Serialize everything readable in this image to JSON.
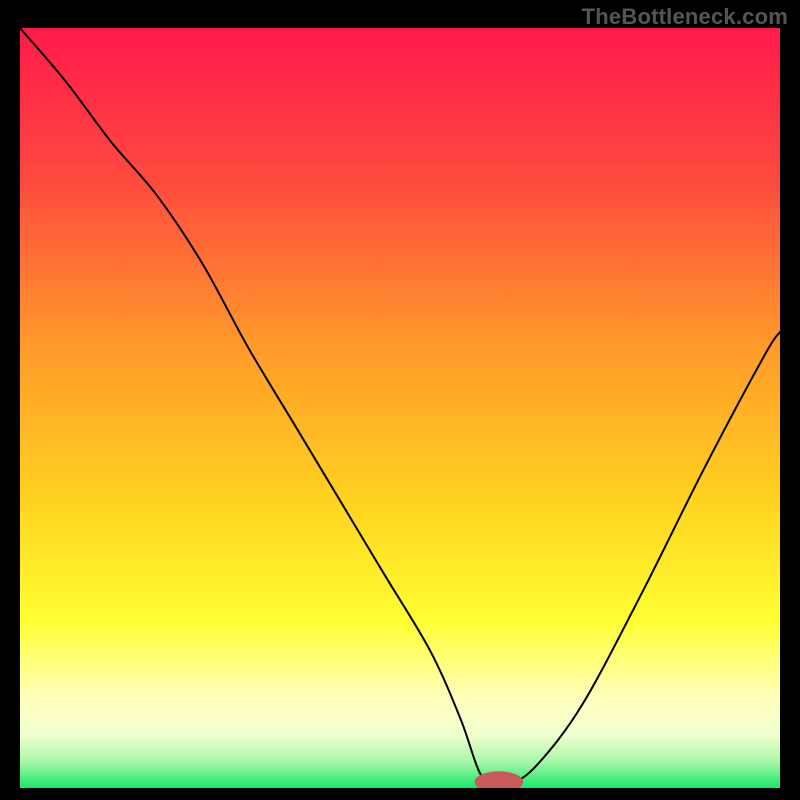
{
  "watermark": "TheBottleneck.com",
  "chart_data": {
    "type": "line",
    "title": "",
    "xlabel": "",
    "ylabel": "",
    "xlim": [
      0,
      100
    ],
    "ylim": [
      0,
      100
    ],
    "gradient_stops": [
      {
        "offset": 0.0,
        "color": "#ff1a4b"
      },
      {
        "offset": 0.2,
        "color": "#ff4a3e"
      },
      {
        "offset": 0.42,
        "color": "#ff9a2a"
      },
      {
        "offset": 0.62,
        "color": "#ffd21f"
      },
      {
        "offset": 0.78,
        "color": "#ffff33"
      },
      {
        "offset": 0.88,
        "color": "#ffffbb"
      },
      {
        "offset": 0.93,
        "color": "#f0ffd0"
      },
      {
        "offset": 0.965,
        "color": "#a8f7a8"
      },
      {
        "offset": 1.0,
        "color": "#17e86a"
      }
    ],
    "series": [
      {
        "name": "bottleneck-curve",
        "x": [
          0,
          6,
          12,
          18,
          24,
          30,
          36,
          42,
          48,
          54,
          58,
          60.5,
          62.5,
          64.5,
          68,
          74,
          82,
          90,
          98,
          100
        ],
        "y": [
          100,
          93,
          85,
          78,
          69,
          58,
          48,
          38,
          28,
          18,
          9,
          2,
          0.5,
          0.5,
          3,
          11,
          26,
          42,
          57,
          60
        ]
      }
    ],
    "marker": {
      "name": "optimal-marker",
      "x": 63,
      "y": 0.8,
      "rx": 3.2,
      "ry": 1.4,
      "color": "#c85a5a"
    }
  }
}
